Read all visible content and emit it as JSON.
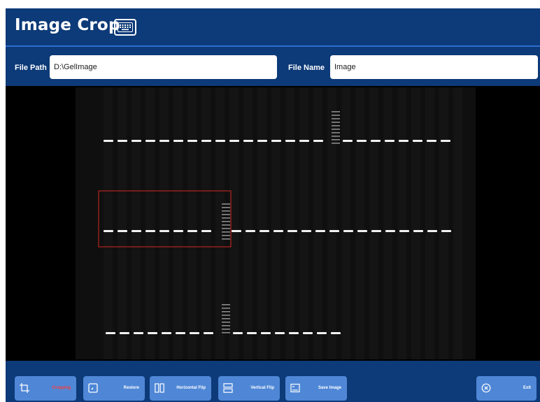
{
  "header": {
    "title": "Image Crop",
    "keyboard_icon": "keyboard-icon"
  },
  "path_bar": {
    "file_path_label": "File Path",
    "file_path_value": "D:\\GelImage",
    "file_name_label": "File Name",
    "file_name_value": "Image"
  },
  "viewer": {
    "content": "gel electrophoresis image",
    "crop_selection_color": "#b3241f"
  },
  "toolbar": {
    "buttons": [
      {
        "label": "Cropping",
        "icon": "crop-icon",
        "active": true
      },
      {
        "label": "Restore",
        "icon": "restore-icon",
        "active": false
      },
      {
        "label": "Horizontal Flip",
        "icon": "horizontal-flip-icon",
        "active": false
      },
      {
        "label": "Vertical Flip",
        "icon": "vertical-flip-icon",
        "active": false
      },
      {
        "label": "Save Image",
        "icon": "save-image-icon",
        "active": false
      },
      {
        "label": "Exit",
        "icon": "exit-icon",
        "active": false
      }
    ]
  },
  "colors": {
    "background": "#0d3a78",
    "button": "#4f87d6",
    "active_text": "#ff3a3a",
    "divider": "#2f6fd0"
  }
}
